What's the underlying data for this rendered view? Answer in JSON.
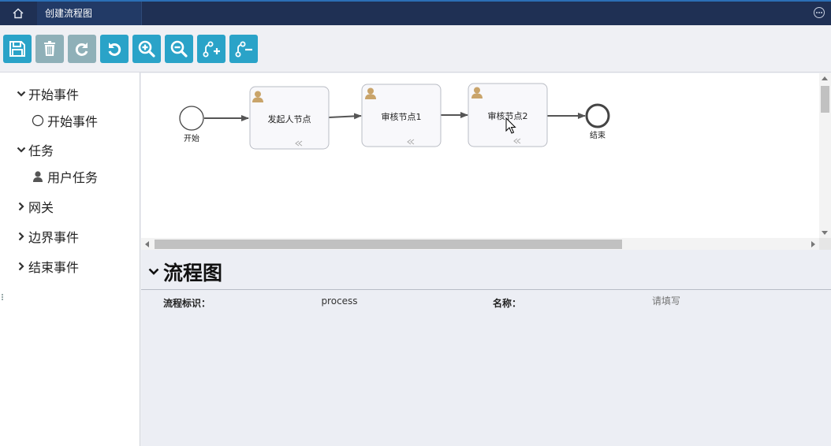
{
  "window": {
    "tab_title": "创建流程图"
  },
  "toolbar": {
    "buttons": [
      {
        "icon": "save-icon",
        "state": "active"
      },
      {
        "icon": "trash-icon",
        "state": "disabled"
      },
      {
        "icon": "redo-icon",
        "state": "disabled"
      },
      {
        "icon": "undo-icon",
        "state": "active"
      },
      {
        "icon": "zoom-in-icon",
        "state": "active"
      },
      {
        "icon": "zoom-out-icon",
        "state": "active"
      },
      {
        "icon": "add-connection-icon",
        "state": "active"
      },
      {
        "icon": "remove-connection-icon",
        "state": "active"
      }
    ]
  },
  "palette": {
    "groups": [
      {
        "label": "开始事件",
        "expanded": true,
        "items": [
          {
            "label": "开始事件",
            "icon": "circle-icon"
          }
        ]
      },
      {
        "label": "任务",
        "expanded": true,
        "items": [
          {
            "label": "用户任务",
            "icon": "user-icon"
          }
        ]
      },
      {
        "label": "网关",
        "expanded": false,
        "items": []
      },
      {
        "label": "边界事件",
        "expanded": false,
        "items": []
      },
      {
        "label": "结束事件",
        "expanded": false,
        "items": []
      }
    ]
  },
  "diagram": {
    "start_event": {
      "label": "开始"
    },
    "tasks": [
      {
        "label": "发起人节点"
      },
      {
        "label": "审核节点1"
      },
      {
        "label": "审核节点2"
      }
    ],
    "end_event": {
      "label": "结束"
    }
  },
  "properties": {
    "title": "流程图",
    "process_id_label": "流程标识：",
    "process_id_value": "process",
    "name_label": "名称：",
    "name_placeholder": "请填写"
  },
  "colors": {
    "topbar": "#1f3054",
    "toolbar_button": "#2aa3c8",
    "toolbar_button_disabled": "#8fb0b8",
    "task_icon": "#c9a46a"
  }
}
